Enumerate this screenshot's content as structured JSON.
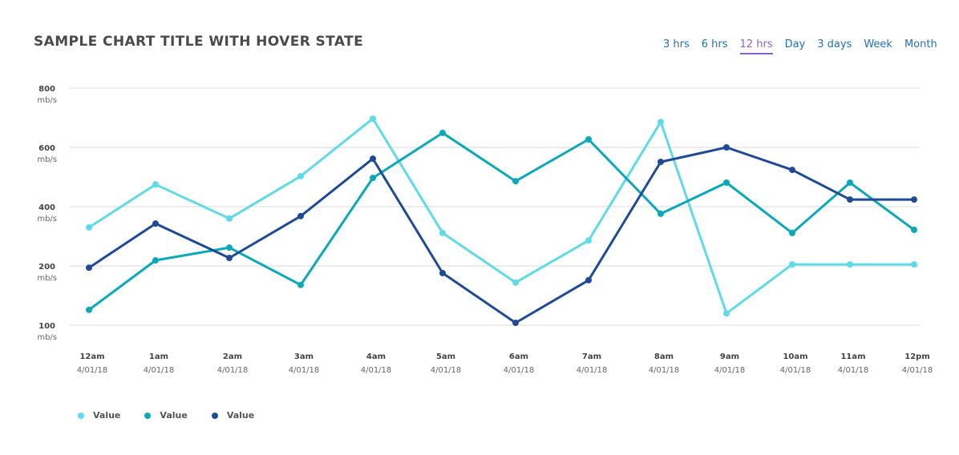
{
  "chart_data": {
    "type": "line",
    "title": "SAMPLE CHART TITLE WITH HOVER STATE",
    "xlabel": "",
    "ylabel": "",
    "y_ticks": [
      {
        "value": 800,
        "label": "800",
        "unit": "mb/s"
      },
      {
        "value": 600,
        "label": "600",
        "unit": "mb/s"
      },
      {
        "value": 400,
        "label": "400",
        "unit": "mb/s"
      },
      {
        "value": 200,
        "label": "200",
        "unit": "mb/s"
      },
      {
        "value": 100,
        "label": "100",
        "unit": "mb/s"
      }
    ],
    "ylim": [
      100,
      800
    ],
    "grid": true,
    "legend_position": "bottom-left",
    "categories": [
      {
        "time": "12am",
        "date": "4/01/18"
      },
      {
        "time": "1am",
        "date": "4/01/18"
      },
      {
        "time": "2am",
        "date": "4/01/18"
      },
      {
        "time": "3am",
        "date": "4/01/18"
      },
      {
        "time": "4am",
        "date": "4/01/18"
      },
      {
        "time": "5am",
        "date": "4/01/18"
      },
      {
        "time": "6am",
        "date": "4/01/18"
      },
      {
        "time": "7am",
        "date": "4/01/18"
      },
      {
        "time": "8am",
        "date": "4/01/18"
      },
      {
        "time": "9am",
        "date": "4/01/18"
      },
      {
        "time": "10am",
        "date": "4/01/18"
      },
      {
        "time": "11am",
        "date": "4/01/18"
      },
      {
        "time": "12pm",
        "date": "4/01/18"
      }
    ],
    "series": [
      {
        "name": "Value",
        "color": "#5fdbe8",
        "values": [
          330,
          475,
          360,
          503,
          697,
          311,
          172,
          286,
          686,
          120,
          205,
          205,
          205
        ]
      },
      {
        "name": "Value",
        "color": "#0aa9b9",
        "values": [
          126,
          219,
          262,
          168,
          497,
          649,
          486,
          627,
          376,
          481,
          311,
          481,
          322
        ]
      },
      {
        "name": "Value",
        "color": "#1f4a96",
        "values": [
          197,
          343,
          227,
          368,
          562,
          188,
          104,
          176,
          551,
          600,
          524,
          424,
          424
        ]
      }
    ]
  },
  "time_ranges": [
    {
      "label": "3 hrs",
      "active": false
    },
    {
      "label": "6 hrs",
      "active": false
    },
    {
      "label": "12 hrs",
      "active": true
    },
    {
      "label": "Day",
      "active": false
    },
    {
      "label": "3 days",
      "active": false
    },
    {
      "label": "Week",
      "active": false
    },
    {
      "label": "Month",
      "active": false
    }
  ],
  "colors": {
    "accent_active": "#8a62c9",
    "link": "#1f6fbf"
  }
}
